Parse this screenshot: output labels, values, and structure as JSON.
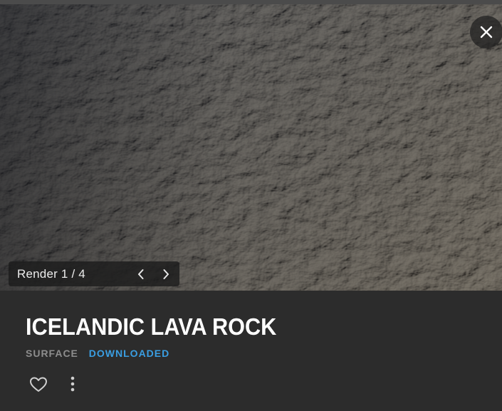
{
  "preview": {
    "render_label": "Render 1 / 4",
    "close_icon": "close-icon",
    "prev_icon": "chevron-left-icon",
    "next_icon": "chevron-right-icon"
  },
  "asset": {
    "title": "ICELANDIC LAVA ROCK",
    "type": "SURFACE",
    "status": "DOWNLOADED"
  },
  "actions": {
    "favorite_icon": "heart-icon",
    "more_icon": "more-vertical-icon"
  },
  "colors": {
    "panel_bg": "#2c2c2c",
    "title": "#ffffff",
    "type_label": "#8d8d8d",
    "status_accent": "#3a9ee2"
  }
}
